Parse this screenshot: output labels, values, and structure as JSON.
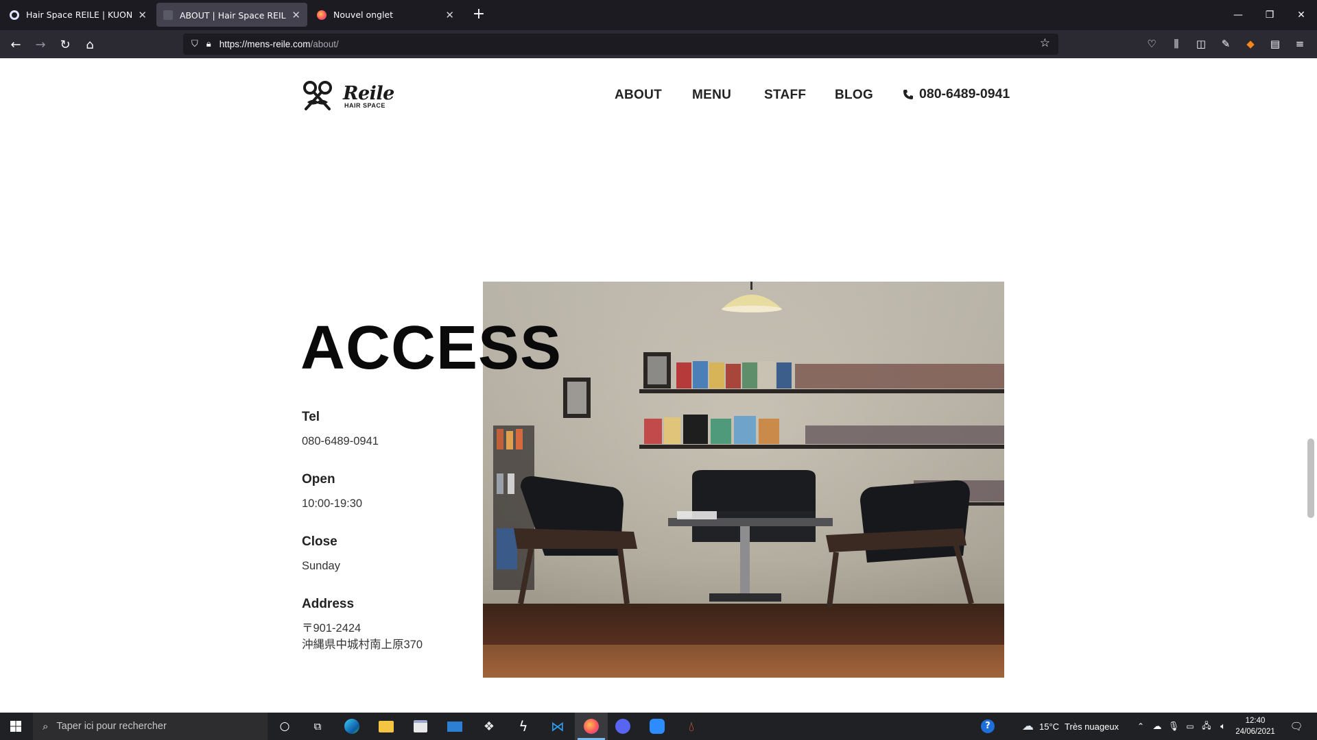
{
  "browser": {
    "tabs": [
      {
        "title": "Hair Space REILE | KUON YAGI P",
        "active": false
      },
      {
        "title": "ABOUT | Hair Space REILE - ヘア",
        "active": true
      },
      {
        "title": "Nouvel onglet",
        "active": false
      }
    ],
    "url_host": "https://mens-reile.com",
    "url_path": "/about/"
  },
  "site": {
    "logo_text": "Reile",
    "logo_sub": "HAIR SPACE",
    "nav": [
      "ABOUT",
      "MENU",
      "STAFF",
      "BLOG"
    ],
    "phone": "080-6489-0941"
  },
  "access": {
    "title": "ACCESS",
    "items": [
      {
        "label": "Tel",
        "value": "080-6489-0941"
      },
      {
        "label": "Open",
        "value": "10:00-19:30"
      },
      {
        "label": "Close",
        "value": "Sunday"
      },
      {
        "label": "Address",
        "value": "〒901-2424",
        "value2": "沖縄県中城村南上原370"
      }
    ]
  },
  "taskbar": {
    "search_placeholder": "Taper ici pour rechercher",
    "weather_temp": "15°C",
    "weather_text": "Très nuageux",
    "time": "12:40",
    "date": "24/06/2021"
  }
}
